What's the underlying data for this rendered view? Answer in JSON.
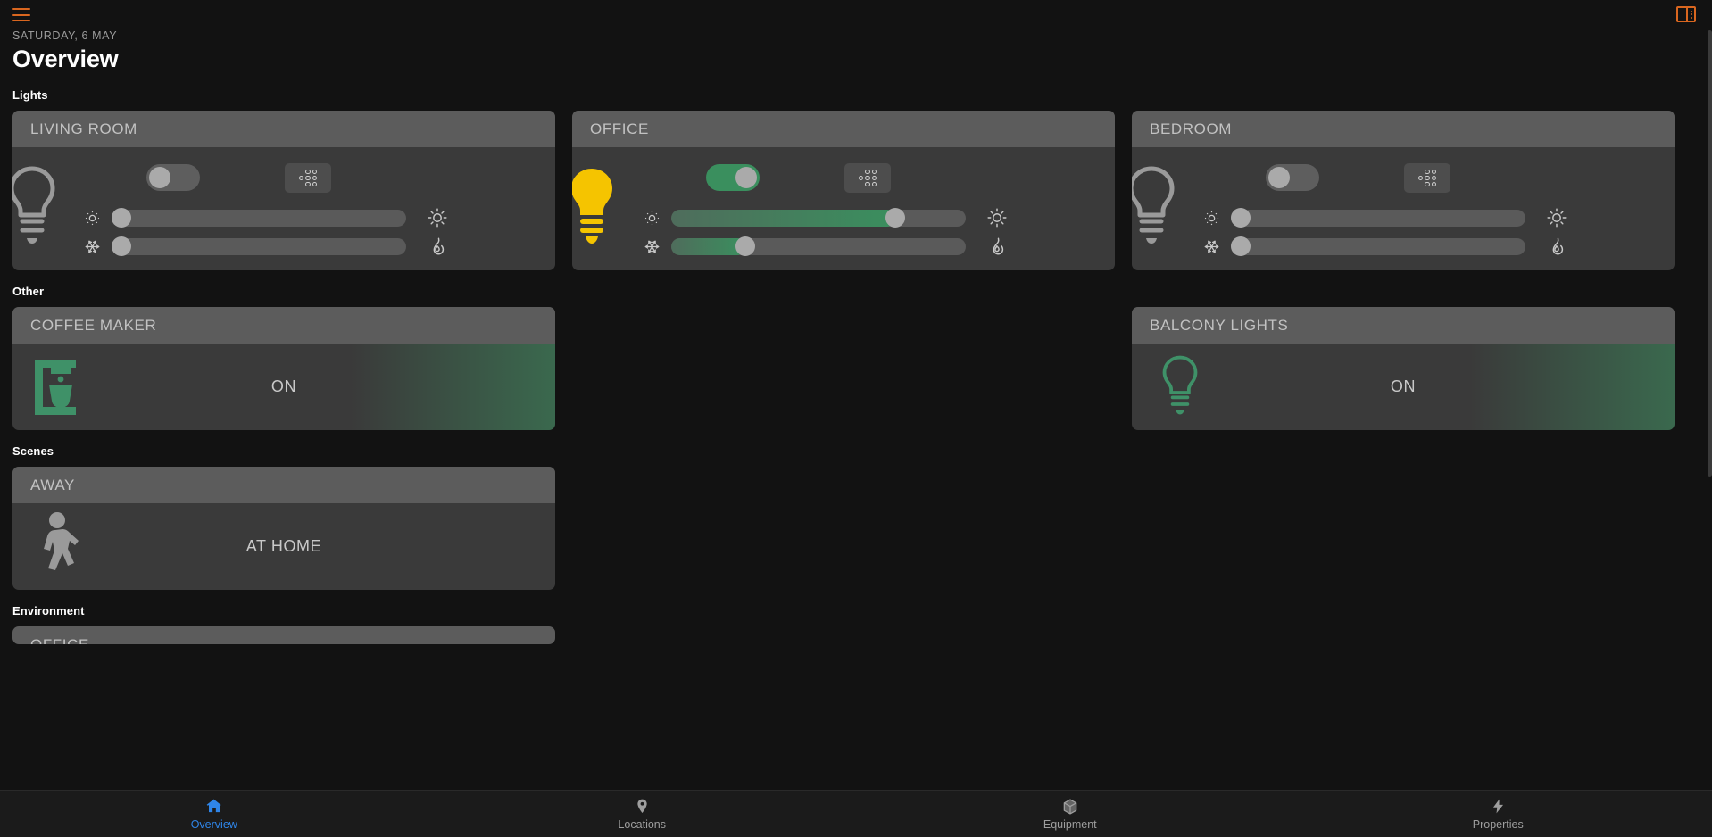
{
  "topbar": {
    "menu_icon": "hamburger-icon",
    "panel_icon": "sidebar-panel-icon",
    "accent_color": "#d9661f"
  },
  "header": {
    "date": "SATURDAY, 6 MAY",
    "title": "Overview"
  },
  "sections": {
    "lights": "Lights",
    "other": "Other",
    "scenes": "Scenes",
    "environment": "Environment"
  },
  "lights": [
    {
      "name": "LIVING ROOM",
      "power": false,
      "bulb_icon": "lightbulb-icon",
      "bulb_color": "#9a9a9a",
      "toggle_icon": "power-toggle",
      "color_button_icon": "color-palette-dots-icon",
      "brightness": {
        "value": 0,
        "low_icon": "sun-dim-icon",
        "high_icon": "sun-bright-icon"
      },
      "temperature": {
        "value": 0,
        "cool_icon": "snowflake-icon",
        "warm_icon": "flame-icon"
      }
    },
    {
      "name": "OFFICE",
      "power": true,
      "bulb_icon": "lightbulb-icon",
      "bulb_color": "#f5c400",
      "toggle_icon": "power-toggle",
      "color_button_icon": "color-palette-dots-icon",
      "brightness": {
        "value": 76,
        "low_icon": "sun-dim-icon",
        "high_icon": "sun-bright-icon"
      },
      "temperature": {
        "value": 25,
        "cool_icon": "snowflake-icon",
        "warm_icon": "flame-icon"
      }
    },
    {
      "name": "BEDROOM",
      "power": false,
      "bulb_icon": "lightbulb-icon",
      "bulb_color": "#9a9a9a",
      "toggle_icon": "power-toggle",
      "color_button_icon": "color-palette-dots-icon",
      "brightness": {
        "value": 0,
        "low_icon": "sun-dim-icon",
        "high_icon": "sun-bright-icon"
      },
      "temperature": {
        "value": 0,
        "cool_icon": "snowflake-icon",
        "warm_icon": "flame-icon"
      }
    }
  ],
  "other": [
    {
      "name": "COFFEE MAKER",
      "state": "ON",
      "active": true,
      "icon": "coffee-maker-icon",
      "icon_color": "#3f9168"
    },
    {
      "name": "BALCONY LIGHTS",
      "state": "ON",
      "active": true,
      "icon": "lightbulb-outline-icon",
      "icon_color": "#3f9168"
    }
  ],
  "scenes": [
    {
      "name": "AWAY",
      "state": "AT HOME",
      "active": false,
      "icon": "walking-person-icon",
      "icon_color": "#9a9a9a"
    }
  ],
  "environment": [
    {
      "name": "OFFICE"
    }
  ],
  "bottom_nav": [
    {
      "label": "Overview",
      "icon": "home-icon",
      "active": true
    },
    {
      "label": "Locations",
      "icon": "map-pin-icon",
      "active": false
    },
    {
      "label": "Equipment",
      "icon": "cube-icon",
      "active": false
    },
    {
      "label": "Properties",
      "icon": "lightning-bolt-icon",
      "active": false
    }
  ],
  "colors": {
    "background": "#121212",
    "card": "#3a3a3a",
    "card_header": "#5c5c5c",
    "accent_green": "#3a8f5e",
    "accent_orange": "#d9661f",
    "accent_blue": "#2f85e8",
    "bulb_on": "#f5c400"
  }
}
